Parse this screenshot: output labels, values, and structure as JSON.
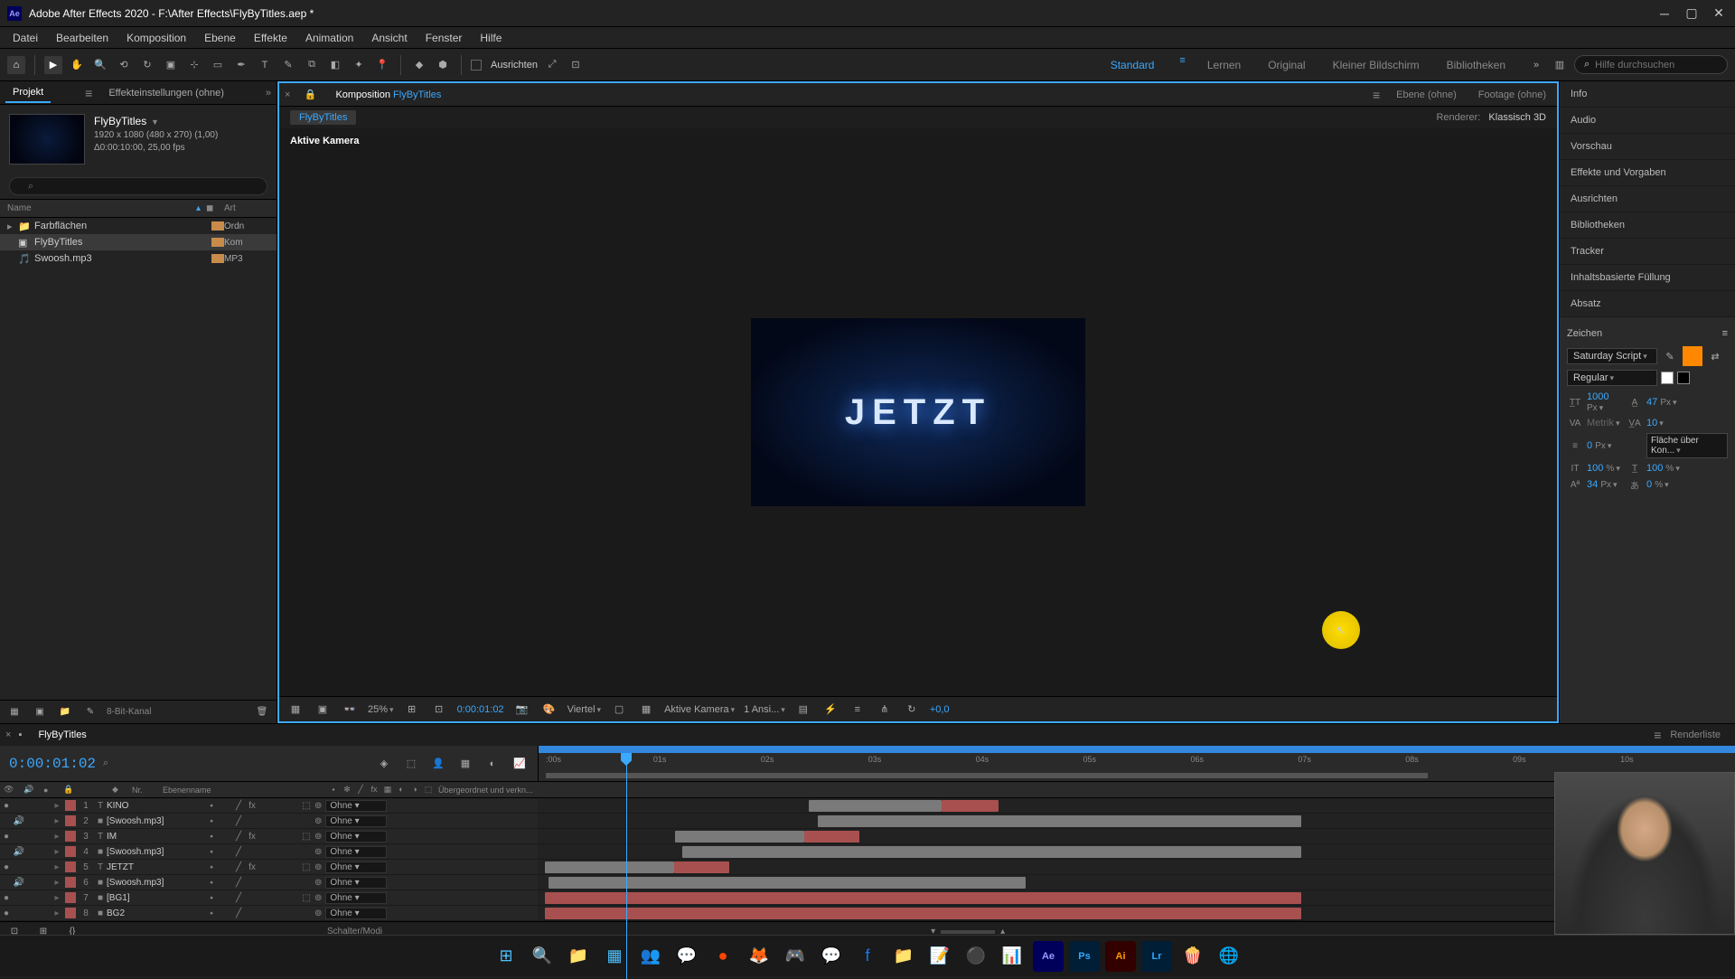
{
  "window": {
    "title": "Adobe After Effects 2020 - F:\\After Effects\\FlyByTitles.aep *",
    "app_initials": "Ae"
  },
  "menu": [
    "Datei",
    "Bearbeiten",
    "Komposition",
    "Ebene",
    "Effekte",
    "Animation",
    "Ansicht",
    "Fenster",
    "Hilfe"
  ],
  "toolbar": {
    "snap_label": "Ausrichten"
  },
  "workspaces": {
    "items": [
      "Standard",
      "Lernen",
      "Original",
      "Kleiner Bildschirm",
      "Bibliotheken"
    ],
    "active": 0
  },
  "help_search_placeholder": "Hilfe durchsuchen",
  "project_panel": {
    "tab_project": "Projekt",
    "tab_effect": "Effekteinstellungen (ohne)",
    "comp_name": "FlyByTitles",
    "dims": "1920 x 1080 (480 x 270) (1,00)",
    "duration": "Δ0:00:10:00, 25,00 fps",
    "col_name": "Name",
    "col_art": "Art",
    "items": [
      {
        "name": "Farbflächen",
        "type": "Ordn",
        "icon": "folder",
        "expand": "▸"
      },
      {
        "name": "FlyByTitles",
        "type": "Kom",
        "icon": "comp",
        "expand": ""
      },
      {
        "name": "Swoosh.mp3",
        "type": "MP3",
        "icon": "audio",
        "expand": ""
      }
    ],
    "bit_depth": "8-Bit-Kanal"
  },
  "comp_panel": {
    "tab_comp": "Komposition",
    "tab_comp_name": "FlyByTitles",
    "tab_layer": "Ebene (ohne)",
    "tab_footage": "Footage (ohne)",
    "breadcrumb": "FlyByTitles",
    "renderer_label": "Renderer:",
    "renderer_value": "Klassisch 3D",
    "camera_label": "Aktive Kamera",
    "preview_text": "JETZT",
    "zoom": "25%",
    "timecode": "0:00:01:02",
    "res": "Viertel",
    "view_cam": "Aktive Kamera",
    "views": "1 Ansi...",
    "exposure": "+0,0"
  },
  "right_panels": [
    "Info",
    "Audio",
    "Vorschau",
    "Effekte und Vorgaben",
    "Ausrichten",
    "Bibliotheken",
    "Tracker",
    "Inhaltsbasierte Füllung",
    "Absatz"
  ],
  "character": {
    "title": "Zeichen",
    "font": "Saturday Script",
    "style": "Regular",
    "fill_color": "#ff8800",
    "size": "1000",
    "size_unit": "Px",
    "leading": "47",
    "leading_unit": "Px",
    "kerning": "Metrik",
    "tracking": "10",
    "stroke": "0",
    "stroke_unit": "Px",
    "stroke_type": "Fläche über Kon...",
    "vscale": "100",
    "vscale_unit": "%",
    "hscale": "100",
    "hscale_unit": "%",
    "baseline": "34",
    "baseline_unit": "Px",
    "tsume": "0",
    "tsume_unit": "%"
  },
  "timeline": {
    "tab_name": "FlyByTitles",
    "tab_render": "Renderliste",
    "timecode": "0:00:01:02",
    "col_nr": "Nr.",
    "col_name": "Ebenenname",
    "col_parent": "Übergeordnet und verkn...",
    "parent_none": "Ohne",
    "switches_label": "Schalter/Modi",
    "ruler": [
      ":00s",
      "01s",
      "02s",
      "03s",
      "04s",
      "05s",
      "06s",
      "07s",
      "08s",
      "09s",
      "10s"
    ],
    "layers": [
      {
        "n": "1",
        "name": "KINO",
        "type": "T",
        "color": "#a85050",
        "eye": "●",
        "spk": "",
        "threed": true,
        "clip_start": 300,
        "clip_end": 510,
        "clip2_start": null
      },
      {
        "n": "2",
        "name": "[Swoosh.mp3]",
        "type": "",
        "color": "#a85050",
        "eye": "",
        "spk": "🔊",
        "threed": false,
        "clip_start": 310,
        "clip_end": 845
      },
      {
        "n": "3",
        "name": "IM",
        "type": "T",
        "color": "#a85050",
        "eye": "●",
        "spk": "",
        "threed": true,
        "clip_start": 152,
        "clip_end": 356
      },
      {
        "n": "4",
        "name": "[Swoosh.mp3]",
        "type": "",
        "color": "#a85050",
        "eye": "",
        "spk": "🔊",
        "threed": false,
        "clip_start": 160,
        "clip_end": 845
      },
      {
        "n": "5",
        "name": "JETZT",
        "type": "T",
        "color": "#a85050",
        "eye": "●",
        "spk": "",
        "threed": true,
        "clip_start": 8,
        "clip_end": 212
      },
      {
        "n": "6",
        "name": "[Swoosh.mp3]",
        "type": "",
        "color": "#a85050",
        "eye": "",
        "spk": "🔊",
        "threed": false,
        "clip_start": 12,
        "clip_end": 540
      },
      {
        "n": "7",
        "name": "[BG1]",
        "type": "",
        "color": "#a85050",
        "eye": "●",
        "spk": "",
        "threed": true,
        "clip_start": 8,
        "clip_end": 845
      },
      {
        "n": "8",
        "name": "BG2",
        "type": "",
        "color": "#a85050",
        "eye": "●",
        "spk": "",
        "threed": false,
        "clip_start": 8,
        "clip_end": 845
      }
    ]
  }
}
